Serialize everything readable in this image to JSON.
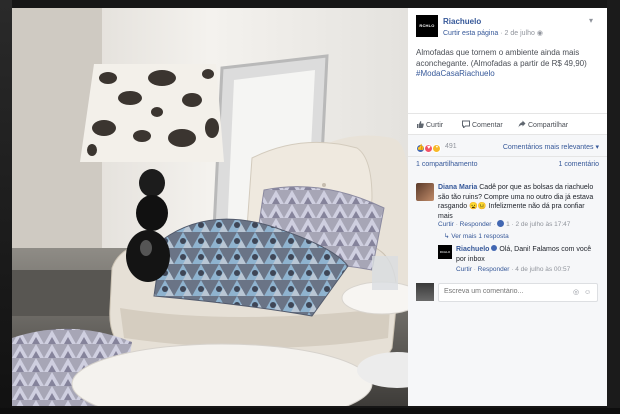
{
  "post": {
    "page_name": "Riachuelo",
    "logo_text": "RCHLO",
    "like_page": "Curtir esta página",
    "date": "2 de julho",
    "text": "Almofadas que tornem o ambiente ainda mais aconchegante. (Almofadas a partir de R$ 49,90)",
    "hashtag": "#ModaCasaRiachuelo"
  },
  "actions": {
    "like": "Curtir",
    "comment": "Comentar",
    "share": "Compartilhar"
  },
  "reactions": {
    "count": "491",
    "sort_label": "Comentários mais relevantes"
  },
  "stats": {
    "shares": "1 compartilhamento",
    "comments": "1 comentário"
  },
  "comments": [
    {
      "name": "Diana Maria",
      "text": "Cadê por que as bolsas da riachuelo são tão ruins? Compre uma no outro dia já estava rasgando 😦😐 Infelizmente não dá pra confiar mais",
      "like": "Curtir",
      "reply": "Responder",
      "likes": "1",
      "date": "2 de julho às 17:47",
      "more_replies": "Ver mais 1 resposta"
    },
    {
      "name": "Riachuelo",
      "text": "Olá, Dani! Falamos com você por inbox",
      "like": "Curtir",
      "reply": "Responder",
      "date": "4 de julho às 00:57"
    }
  ],
  "composer": {
    "placeholder": "Escreva um comentário..."
  },
  "colors": {
    "link": "#365899",
    "muted": "#90949c",
    "panel_bg": "#f6f7f9"
  }
}
